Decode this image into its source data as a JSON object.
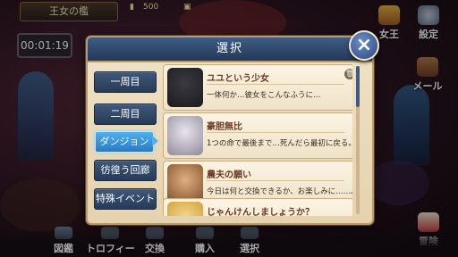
{
  "top": {
    "title": "王女の檻",
    "timer": "00:01:19",
    "currency_amount": "500"
  },
  "right_menu": [
    {
      "label": "女王",
      "icon": "crown-icon"
    },
    {
      "label": "設定",
      "icon": "gear-icon"
    },
    {
      "label": "メール",
      "icon": "mail-icon"
    },
    {
      "label": "冒険",
      "icon": "adventure-icon"
    }
  ],
  "bottom_menu": [
    {
      "label": "図鑑",
      "icon": "book-icon"
    },
    {
      "label": "トロフィー",
      "icon": "trophy-icon"
    },
    {
      "label": "交換",
      "icon": "exchange-icon"
    },
    {
      "label": "購入",
      "icon": "shop-icon"
    },
    {
      "label": "選択",
      "icon": "select-icon"
    }
  ],
  "dialog": {
    "title": "選択",
    "close_label": "×",
    "tabs": [
      {
        "label": "一周目",
        "active": false
      },
      {
        "label": "二周目",
        "active": false
      },
      {
        "label": "ダンジョン",
        "active": true
      },
      {
        "label": "彷徨う回廊",
        "active": false
      },
      {
        "label": "特殊イベント",
        "active": false
      }
    ],
    "items": [
      {
        "title": "ユユという少女",
        "desc": "一体何か…彼女をこんなふうに…"
      },
      {
        "title": "豪胆無比",
        "desc": "1つの命で最後まで…死んだら最初に戻る。"
      },
      {
        "title": "農夫の願い",
        "desc": "今日は何と交換できるか、お楽しみに……。"
      },
      {
        "title": "じゃんけんしましょうか？",
        "desc": ""
      }
    ]
  },
  "colors": {
    "header": "#2f4a70",
    "active_tab": "#3a94e0",
    "panel": "#ecdcbc"
  }
}
